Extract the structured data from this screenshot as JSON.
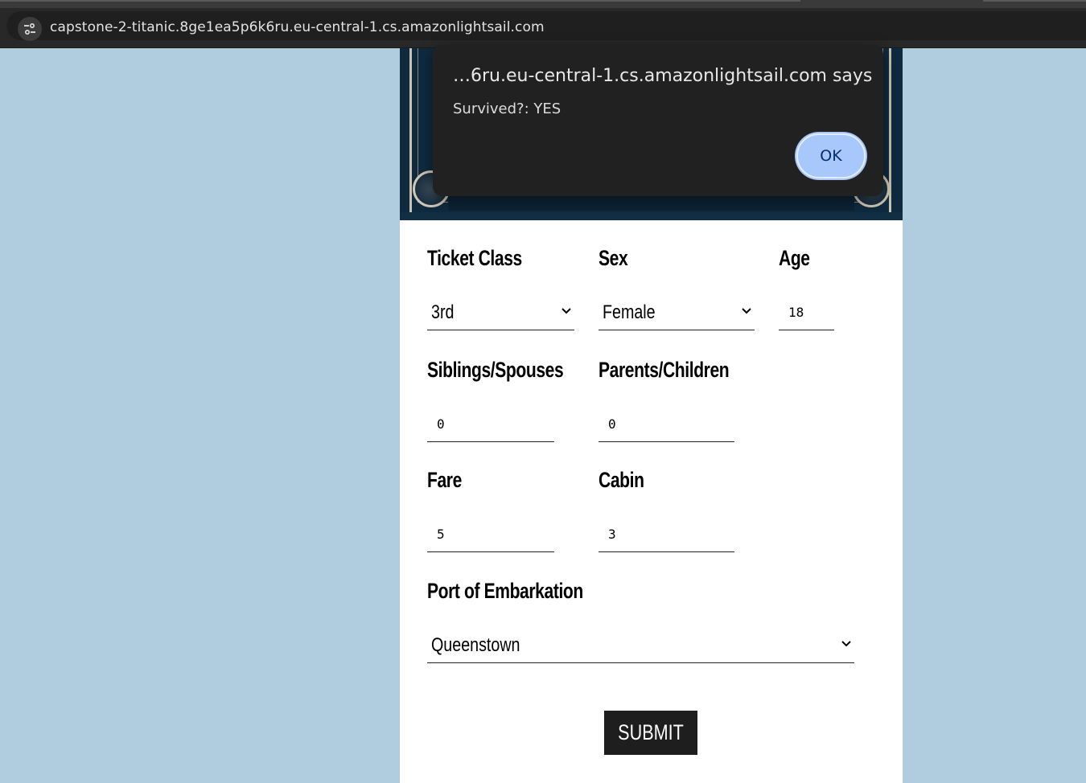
{
  "browser": {
    "url": "capstone-2-titanic.8ge1ea5p6k6ru.eu-central-1.cs.amazonlightsail.com",
    "site_info_icon": "tune-icon"
  },
  "dialog": {
    "title": "…6ru.eu-central-1.cs.amazonlightsail.com says",
    "message": "Survived?: YES",
    "ok_label": "OK"
  },
  "form": {
    "ticket_class": {
      "label": "Ticket Class",
      "value": "3rd"
    },
    "sex": {
      "label": "Sex",
      "value": "Female"
    },
    "age": {
      "label": "Age",
      "value": "18"
    },
    "siblings_spouses": {
      "label": "Siblings/Spouses",
      "value": "0"
    },
    "parents_children": {
      "label": "Parents/Children",
      "value": "0"
    },
    "fare": {
      "label": "Fare",
      "value": "5"
    },
    "cabin": {
      "label": "Cabin",
      "value": "3"
    },
    "port": {
      "label": "Port of Embarkation",
      "value": "Queenstown"
    },
    "submit_label": "SUBMIT"
  },
  "colors": {
    "page_background": "#b0cde0",
    "dialog_background": "#212121",
    "ok_button": "#a8c7fa",
    "submit_button": "#1e1e1e"
  }
}
